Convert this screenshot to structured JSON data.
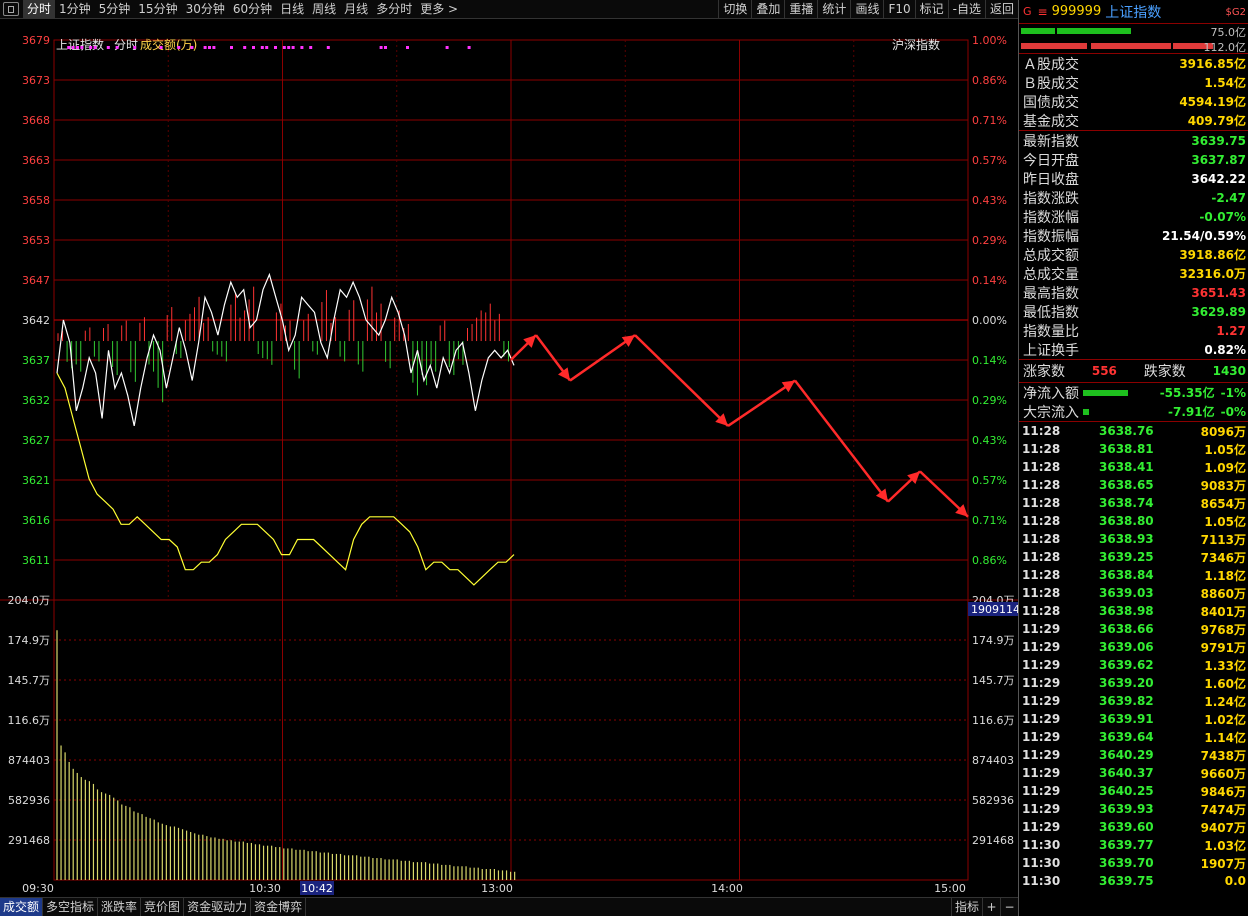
{
  "topbar": {
    "tabs": [
      "分时",
      "1分钟",
      "5分钟",
      "15分钟",
      "30分钟",
      "60分钟",
      "日线",
      "周线",
      "月线",
      "多分时",
      "更多 >"
    ],
    "right": [
      "切换",
      "叠加",
      "重播",
      "统计",
      "画线",
      "F10",
      "标记",
      "-自选",
      "返回"
    ]
  },
  "chart_header": {
    "index": "上证指数",
    "mode": "分时",
    "metric": "成交额(万)",
    "overlay": "沪深指数"
  },
  "price_axis": {
    "left": [
      "3679",
      "3673",
      "3668",
      "3663",
      "3658",
      "3653",
      "3647",
      "3642",
      "3637",
      "3632",
      "3627",
      "3621",
      "3616",
      "3611"
    ],
    "right": [
      "1.00%",
      "0.86%",
      "0.71%",
      "0.57%",
      "0.43%",
      "0.29%",
      "0.14%",
      "0.00%",
      "0.14%",
      "0.29%",
      "0.43%",
      "0.57%",
      "0.71%",
      "0.86%"
    ]
  },
  "vol_axis": {
    "top_left": "204.0万",
    "top_right": "204.0万",
    "cursor": "1909114",
    "labels": [
      "174.9万",
      "145.7万",
      "116.6万",
      "874403",
      "582936",
      "291468"
    ]
  },
  "time_axis": {
    "labels": [
      "09:30",
      "10:30",
      "13:00",
      "14:00",
      "15:00"
    ],
    "cursor": "10:42"
  },
  "colors": {
    "up": "#ff3333",
    "down": "#33cc33",
    "price": "#ffffff",
    "avg": "#ffff33",
    "volume": "#d8d86a",
    "grid": "#8b0000",
    "arrow": "#ff2a2a",
    "magenta": "#ff33ff"
  },
  "bottombar": {
    "tabs": [
      "成交额",
      "多空指标",
      "涨跌率",
      "竞价图",
      "资金驱动力",
      "资金博弈"
    ],
    "right": [
      "指标",
      "+",
      "−"
    ]
  },
  "side": {
    "g": "G",
    "eq": "≡",
    "code": "999999",
    "name": "上证指数",
    "sg": "$G2",
    "bars": [
      {
        "v": "75.0亿"
      },
      {
        "v": "112.0亿"
      }
    ],
    "turnover": [
      {
        "k": "Ａ股成交",
        "v": "3916.85亿",
        "c": "#ffd700"
      },
      {
        "k": "Ｂ股成交",
        "v": "1.54亿",
        "c": "#ffd700"
      },
      {
        "k": "国债成交",
        "v": "4594.19亿",
        "c": "#ffd700"
      },
      {
        "k": "基金成交",
        "v": "409.79亿",
        "c": "#ffd700"
      }
    ],
    "stats": [
      {
        "k": "最新指数",
        "v": "3639.75",
        "c": "#33ee33"
      },
      {
        "k": "今日开盘",
        "v": "3637.87",
        "c": "#33ee33"
      },
      {
        "k": "昨日收盘",
        "v": "3642.22",
        "c": "#ffffff"
      },
      {
        "k": "指数涨跌",
        "v": "-2.47",
        "c": "#33ee33"
      },
      {
        "k": "指数涨幅",
        "v": "-0.07%",
        "c": "#33ee33"
      },
      {
        "k": "指数振幅",
        "v": "21.54/0.59%",
        "c": "#ffffff"
      },
      {
        "k": "总成交额",
        "v": "3918.86亿",
        "c": "#ffd700"
      },
      {
        "k": "总成交量",
        "v": "32316.0万",
        "c": "#ffd700"
      },
      {
        "k": "最高指数",
        "v": "3651.43",
        "c": "#ff3333"
      },
      {
        "k": "最低指数",
        "v": "3629.89",
        "c": "#33ee33"
      },
      {
        "k": "指数量比",
        "v": "1.27",
        "c": "#ff3333"
      },
      {
        "k": "上证换手",
        "v": "0.82%",
        "c": "#ffffff"
      }
    ],
    "updown": {
      "up_label": "涨家数",
      "up": "556",
      "down_label": "跌家数",
      "down": "1430"
    },
    "flow": [
      {
        "k": "净流入额",
        "v": "-55.35亿",
        "p": "-1%",
        "fill": 0.45
      },
      {
        "k": "大宗流入",
        "v": "-7.91亿",
        "p": "-0%",
        "fill": 0.06
      }
    ],
    "ticks": [
      [
        "11:28",
        "3638.76",
        "8096万"
      ],
      [
        "11:28",
        "3638.81",
        "1.05亿"
      ],
      [
        "11:28",
        "3638.41",
        "1.09亿"
      ],
      [
        "11:28",
        "3638.65",
        "9083万"
      ],
      [
        "11:28",
        "3638.74",
        "8654万"
      ],
      [
        "11:28",
        "3638.80",
        "1.05亿"
      ],
      [
        "11:28",
        "3638.93",
        "7113万"
      ],
      [
        "11:28",
        "3639.25",
        "7346万"
      ],
      [
        "11:28",
        "3638.84",
        "1.18亿"
      ],
      [
        "11:28",
        "3639.03",
        "8860万"
      ],
      [
        "11:28",
        "3638.98",
        "8401万"
      ],
      [
        "11:29",
        "3638.66",
        "9768万"
      ],
      [
        "11:29",
        "3639.06",
        "9791万"
      ],
      [
        "11:29",
        "3639.62",
        "1.33亿"
      ],
      [
        "11:29",
        "3639.20",
        "1.60亿"
      ],
      [
        "11:29",
        "3639.82",
        "1.24亿"
      ],
      [
        "11:29",
        "3639.91",
        "1.02亿"
      ],
      [
        "11:29",
        "3639.64",
        "1.14亿"
      ],
      [
        "11:29",
        "3640.29",
        "7438万"
      ],
      [
        "11:29",
        "3640.37",
        "9660万"
      ],
      [
        "11:29",
        "3640.25",
        "9846万"
      ],
      [
        "11:29",
        "3639.93",
        "7474万"
      ],
      [
        "11:29",
        "3639.60",
        "9407万"
      ],
      [
        "11:30",
        "3639.77",
        "1.03亿"
      ],
      [
        "11:30",
        "3639.70",
        "1907万"
      ],
      [
        "11:30",
        "3639.75",
        "0.0"
      ]
    ]
  },
  "chart_data": {
    "type": "line",
    "title": "上证指数 分时",
    "prev_close": 3642.22,
    "ylim": [
      3608,
      3682
    ],
    "time_minutes_elapsed_shown": [
      0,
      120
    ],
    "price": [
      3638,
      3645,
      3642,
      3633,
      3636,
      3640,
      3638,
      3632,
      3641,
      3636,
      3638,
      3635,
      3631,
      3636,
      3640,
      3643,
      3641,
      3636,
      3640,
      3644,
      3641,
      3637,
      3642,
      3648,
      3646,
      3643,
      3647,
      3650,
      3648,
      3649,
      3644,
      3645,
      3649,
      3651,
      3648,
      3645,
      3641,
      3643,
      3648,
      3647,
      3646,
      3642,
      3640,
      3645,
      3649,
      3648,
      3650,
      3648,
      3645,
      3644,
      3643,
      3645,
      3648,
      3646,
      3643,
      3638,
      3641,
      3637,
      3639,
      3636,
      3640,
      3638,
      3641,
      3642,
      3638,
      3633,
      3637,
      3640,
      3641,
      3640,
      3641,
      3639
    ],
    "avg": [
      3638,
      3636,
      3632,
      3628,
      3624,
      3622,
      3621,
      3620,
      3618,
      3618,
      3619,
      3618,
      3617,
      3616,
      3616,
      3615,
      3612,
      3612,
      3613,
      3613,
      3614,
      3616,
      3617,
      3618,
      3618,
      3618,
      3617,
      3616,
      3614,
      3614,
      3616,
      3616,
      3616,
      3615,
      3614,
      3613,
      3612,
      3616,
      3618,
      3619,
      3619,
      3619,
      3619,
      3618,
      3617,
      3615,
      3612,
      3613,
      3613,
      3612,
      3612,
      3611,
      3610,
      3611,
      3612,
      3613,
      3613,
      3614
    ],
    "pressure_bars": [
      0.3,
      -0.8,
      -0.9,
      0.4,
      -0.6,
      0.5,
      -1.0,
      0.6,
      -1.2,
      0.7,
      -0.9,
      -1.8,
      1.0,
      -0.5,
      0.8,
      1.3,
      0.7,
      -0.4,
      -0.6,
      1.4,
      0.9,
      1.6,
      -0.5,
      -0.7,
      1.1,
      0.6,
      -1.1,
      0.8,
      -0.4,
      1.5,
      0.7,
      -0.6,
      1.2,
      -0.9,
      1.6,
      1.1,
      -0.8,
      0.9,
      0.5,
      -1.6,
      -1.3,
      -0.9,
      0.6,
      -1.0,
      -0.7,
      0.5,
      0.9,
      1.1,
      0.8,
      -0.6
    ],
    "volume_wan": [
      182,
      98,
      93,
      86,
      81,
      78,
      75,
      73,
      72,
      70,
      66,
      64,
      63,
      62,
      60,
      58,
      55,
      54,
      53,
      50,
      49,
      48,
      46,
      45,
      44,
      42,
      41,
      40,
      39,
      39,
      38,
      37,
      36,
      35,
      34,
      33,
      33,
      32,
      31,
      31,
      30,
      30,
      29,
      29,
      28,
      28,
      28,
      27,
      27,
      26,
      26,
      25,
      25,
      25,
      24,
      24,
      23,
      23,
      23,
      22,
      22,
      22,
      21,
      21,
      21,
      20,
      20,
      20,
      19,
      19,
      19,
      18,
      18,
      18,
      18,
      17,
      17,
      17,
      16,
      16,
      16,
      15,
      15,
      15,
      15,
      14,
      14,
      14,
      13,
      13,
      13,
      13,
      12,
      12,
      12,
      11,
      11,
      11,
      10,
      10,
      10,
      10,
      9,
      9,
      9,
      8,
      8,
      8,
      8,
      7,
      7,
      7,
      6,
      6
    ],
    "forecast_arrows": [
      [
        3639.75,
        3643
      ],
      [
        3643,
        3637
      ],
      [
        3637,
        3643
      ],
      [
        3643,
        3631
      ],
      [
        3631,
        3637
      ],
      [
        3637,
        3621
      ],
      [
        3621,
        3625
      ],
      [
        3625,
        3619
      ]
    ]
  }
}
